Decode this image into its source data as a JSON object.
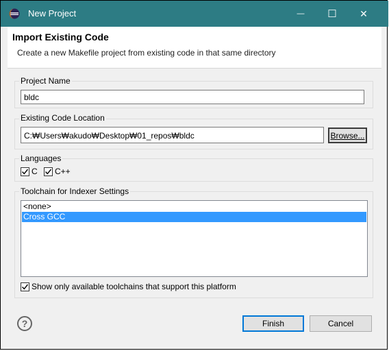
{
  "window": {
    "title": "New Project",
    "minimize_glyph": "—",
    "maximize_glyph": "☐",
    "close_glyph": "✕"
  },
  "header": {
    "title": "Import Existing Code",
    "description": "Create a new Makefile project from existing code in that same directory"
  },
  "project_name": {
    "label": "Project Name",
    "value": "bldc"
  },
  "code_location": {
    "label": "Existing Code Location",
    "value": "C:₩Users₩akudo₩Desktop₩01_repos₩bldc",
    "browse_label": "Browse..."
  },
  "languages": {
    "label": "Languages",
    "items": [
      {
        "label": "C",
        "checked": true
      },
      {
        "label": "C++",
        "checked": true
      }
    ]
  },
  "toolchain": {
    "label": "Toolchain for Indexer Settings",
    "items": [
      {
        "label": "<none>",
        "selected": false
      },
      {
        "label": "Cross GCC",
        "selected": true
      }
    ],
    "filter_label": "Show only available toolchains that support this platform",
    "filter_checked": true
  },
  "footer": {
    "help_glyph": "?",
    "finish_label": "Finish",
    "cancel_label": "Cancel"
  },
  "colors": {
    "titlebar": "#2d7c84",
    "selection": "#3399ff",
    "default_button_border": "#0078d7"
  },
  "icons": {
    "app": "eclipse-icon",
    "help": "help-icon"
  }
}
